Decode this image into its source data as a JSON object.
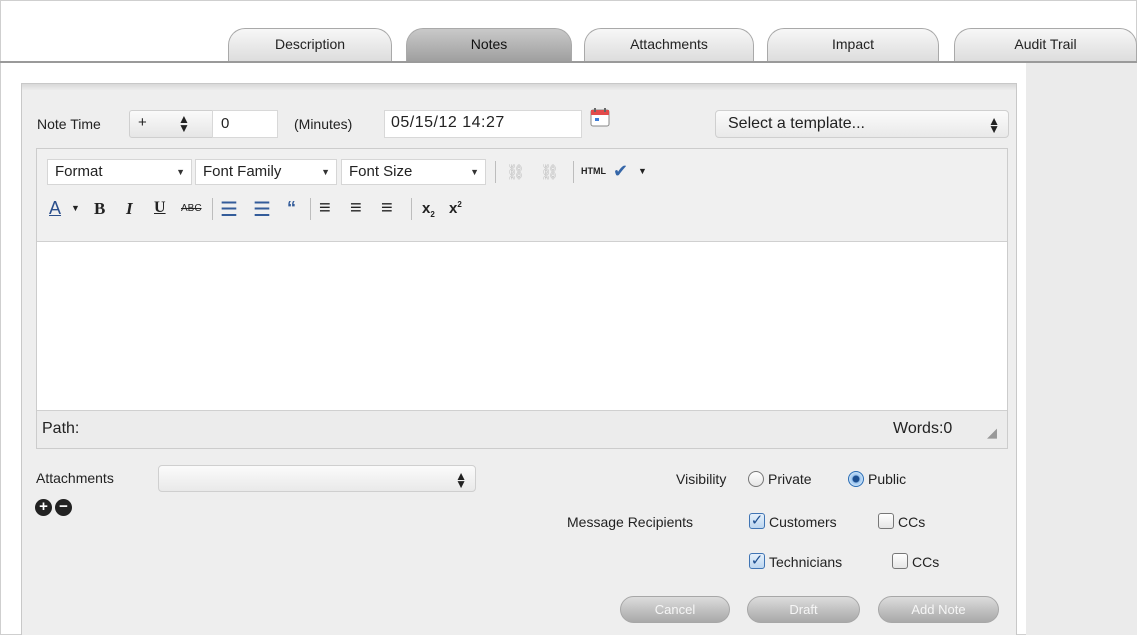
{
  "tabs": [
    {
      "label": "Description",
      "active": false
    },
    {
      "label": "Notes",
      "active": true
    },
    {
      "label": "Attachments",
      "active": false
    },
    {
      "label": "Impact",
      "active": false
    },
    {
      "label": "Audit Trail",
      "active": false
    }
  ],
  "note_time": {
    "label": "Note Time",
    "sign": "+",
    "minutes_value": "0",
    "minutes_label": "(Minutes)",
    "datetime_value": "05/15/12 14:27",
    "template_select": "Select a template..."
  },
  "editor": {
    "format_label": "Format",
    "font_family_label": "Font Family",
    "font_size_label": "Font Size",
    "html_label": "HTML",
    "path_label": "Path:",
    "words_label": "Words:0"
  },
  "attachments": {
    "label": "Attachments",
    "value": ""
  },
  "visibility": {
    "label": "Visibility",
    "options": [
      "Private",
      "Public"
    ],
    "selected": "Public"
  },
  "recipients": {
    "label": "Message Recipients",
    "customers_label": "Customers",
    "customers_checked": true,
    "customers_cc_label": "CCs",
    "customers_cc_checked": false,
    "technicians_label": "Technicians",
    "technicians_checked": true,
    "technicians_cc_label": "CCs",
    "technicians_cc_checked": false
  },
  "buttons": {
    "cancel": "Cancel",
    "draft": "Draft",
    "add_note": "Add Note"
  },
  "colors": {
    "accent_blue": "#2a6db5",
    "panel_bg": "#eeeeee",
    "active_tab": "#b0b0b0"
  }
}
